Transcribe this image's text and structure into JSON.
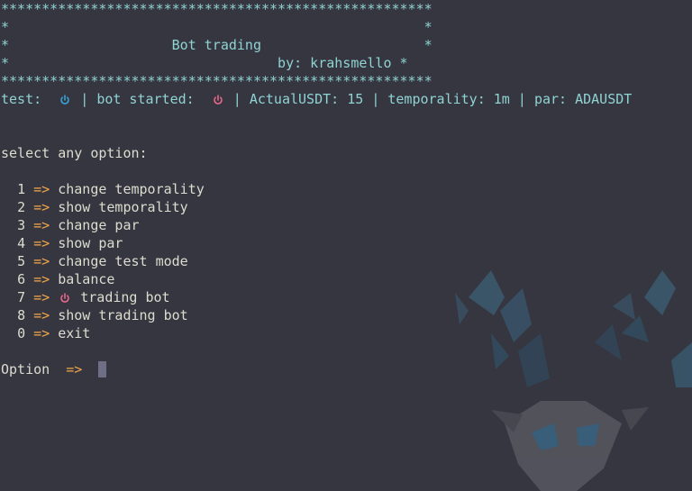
{
  "banner": {
    "border_top": "*****************************************************",
    "empty_row": "*                                                   *",
    "title_row": "*                    Bot trading                    *",
    "author_row": "*                                 by: krahsmello *",
    "border_bottom": "*****************************************************"
  },
  "status": {
    "test_label": "test:",
    "sep1": "|",
    "bot_started_label": "bot started:",
    "sep2": "|",
    "actual_usdt": "ActualUSDT: 15",
    "sep3": "|",
    "temporality": "temporality: 1m",
    "sep4": "|",
    "par": "par: ADAUSDT",
    "colors": {
      "test_icon": "#38a3d6",
      "bot_icon": "#e8678a"
    },
    "icons": {
      "test": "power-icon",
      "bot_started": "power-icon"
    }
  },
  "menu": {
    "prompt": "select any option:",
    "arrow": "=>",
    "items": [
      {
        "num": "1",
        "label": "change temporality"
      },
      {
        "num": "2",
        "label": "show temporality"
      },
      {
        "num": "3",
        "label": "change par"
      },
      {
        "num": "4",
        "label": "show par"
      },
      {
        "num": "5",
        "label": "change test mode"
      },
      {
        "num": "6",
        "label": "balance"
      },
      {
        "num": "7",
        "label": "trading bot",
        "icon": "power-icon"
      },
      {
        "num": "8",
        "label": "show trading bot"
      },
      {
        "num": "0",
        "label": "exit"
      }
    ]
  },
  "input": {
    "label": "Option",
    "arrow": "=>",
    "value": ""
  },
  "theme": {
    "background": "#363640",
    "text": "#dcdccf",
    "accent_cyan": "#8fd3d3",
    "accent_orange": "#f0a64a"
  }
}
